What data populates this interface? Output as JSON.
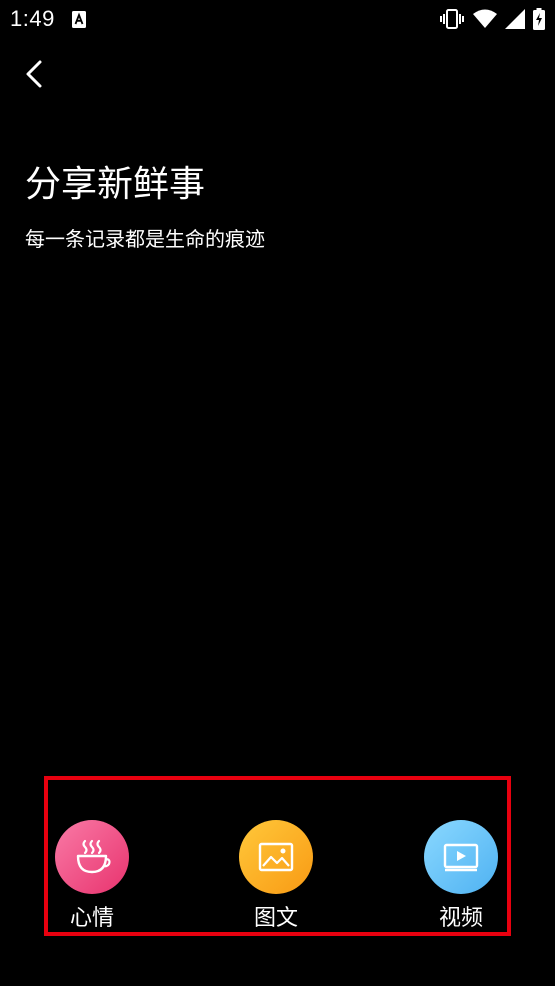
{
  "status_bar": {
    "time": "1:49",
    "notification_icon": "a-box-icon",
    "icons": [
      "vibrate-icon",
      "wifi-icon",
      "signal-icon",
      "battery-charging-icon"
    ]
  },
  "header": {
    "back_icon": "chevron-left-icon",
    "title": "分享新鲜事",
    "subtitle": "每一条记录都是生命的痕迹"
  },
  "actions": [
    {
      "label": "心情",
      "icon": "coffee-cup-icon",
      "color": "#ef4f86"
    },
    {
      "label": "图文",
      "icon": "image-icon",
      "color": "#fbad22"
    },
    {
      "label": "视频",
      "icon": "video-play-icon",
      "color": "#64c3f8"
    }
  ],
  "colors": {
    "background": "#000000",
    "highlight_frame": "#e8000f"
  }
}
